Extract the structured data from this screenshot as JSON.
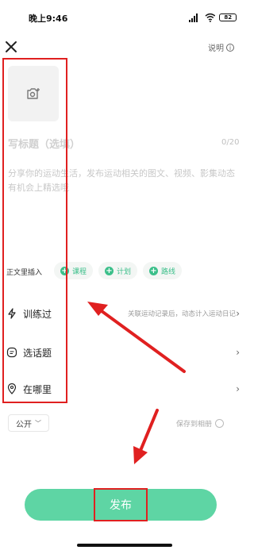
{
  "status_bar": {
    "time": "晚上9:46",
    "battery": "82"
  },
  "header": {
    "explain_label": "说明",
    "info_icon": "i"
  },
  "editor": {
    "title_placeholder": "写标题（选填）",
    "title_counter": "0/20",
    "body_placeholder": "分享你的运动生活，发布运动相关的图文、视频、影集动态有机会上精选哦"
  },
  "insert": {
    "label": "正文里插入",
    "chips": [
      {
        "label": "课程"
      },
      {
        "label": "计划"
      },
      {
        "label": "路线"
      }
    ]
  },
  "rows": [
    {
      "label": "训练过",
      "hint": "关联运动记录后，动态计入运动日记",
      "icon": "lightning-icon"
    },
    {
      "label": "选话题",
      "hint": "",
      "icon": "topic-icon"
    },
    {
      "label": "在哪里",
      "hint": "",
      "icon": "location-pin-icon"
    }
  ],
  "privacy": {
    "visibility": "公开",
    "save_album_label": "保存到相册"
  },
  "publish": {
    "label": "发布"
  },
  "colors": {
    "accent": "#5ed5a4",
    "chip_text": "#3bbf8a",
    "annotation_red": "#e02020"
  }
}
